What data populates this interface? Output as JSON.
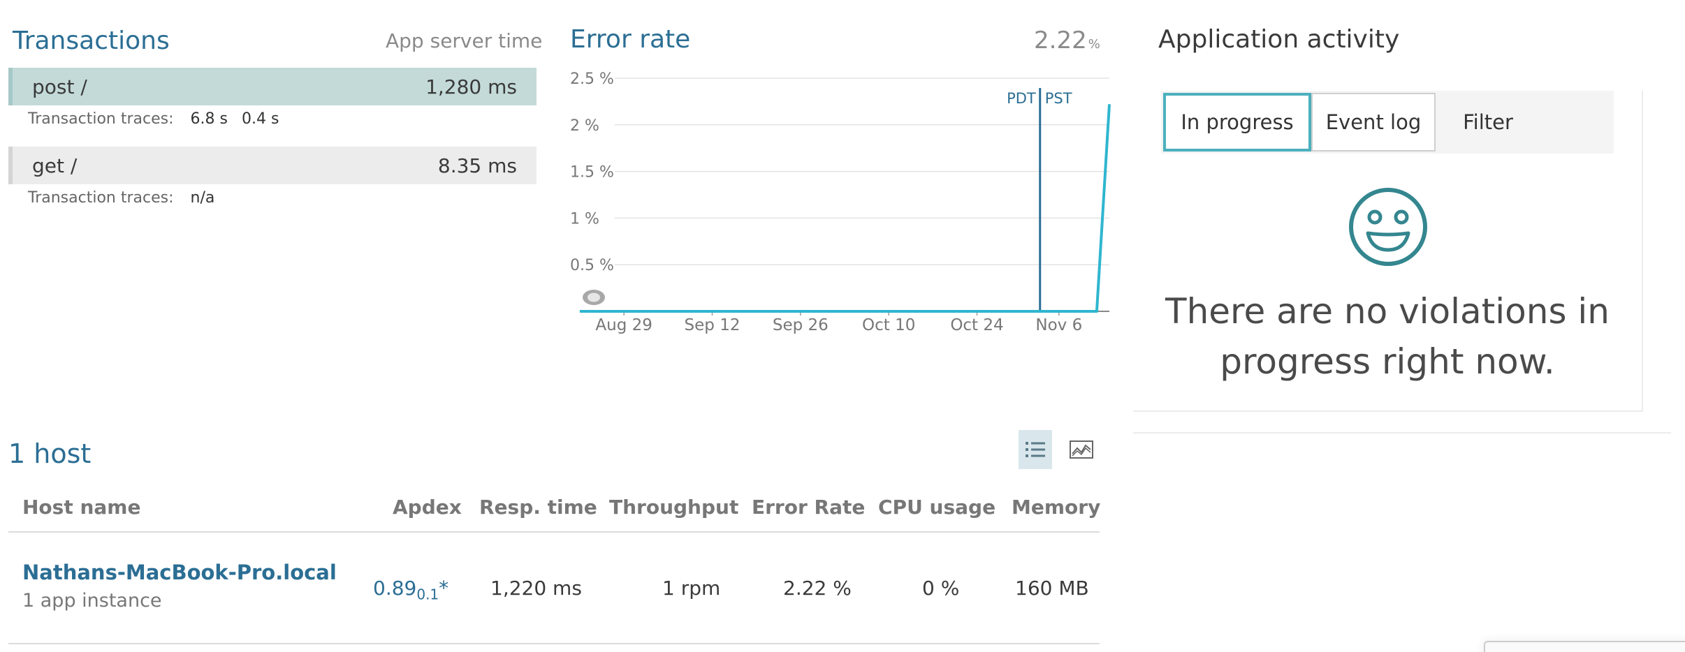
{
  "transactions": {
    "title": "Transactions",
    "subtitle": "App server time",
    "rows": [
      {
        "name": "post /",
        "time": "1,280 ms",
        "traces_label": "Transaction traces:",
        "traces": [
          "6.8 s",
          "0.4 s"
        ]
      },
      {
        "name": "get /",
        "time": "8.35 ms",
        "traces_label": "Transaction traces:",
        "traces_none": "n/a"
      }
    ]
  },
  "error_rate": {
    "title": "Error rate",
    "value": "2.22",
    "unit": "%",
    "timezone_labels": [
      "PDT",
      "PST"
    ]
  },
  "chart_data": {
    "type": "line",
    "title": "Error rate",
    "y_ticks": [
      "2.5 %",
      "2 %",
      "1.5 %",
      "1 %",
      "0.5 %"
    ],
    "x_ticks": [
      "Aug 29",
      "Sep 12",
      "Sep 26",
      "Oct 10",
      "Oct 24",
      "Nov 6"
    ],
    "ylim": [
      0,
      2.5
    ],
    "y_unit": "%",
    "x": [
      "Aug 22",
      "Nov 12",
      "Nov 14"
    ],
    "series": [
      {
        "values": [
          0,
          0,
          2.22
        ],
        "color": "#2fb6cf"
      }
    ],
    "annotation": {
      "label_left": "PDT",
      "label_right": "PST",
      "date": "Nov 3"
    },
    "grid": true
  },
  "activity": {
    "title": "Application activity",
    "tabs": [
      "In progress",
      "Event log",
      "Filter"
    ],
    "active_tab": "In progress",
    "empty_icon": "smiley-face-icon",
    "empty_message": "There are no violations in progress right now."
  },
  "hosts": {
    "title": "1 host",
    "view_icons": [
      "list-view-icon",
      "chart-view-icon"
    ],
    "columns": [
      "Host name",
      "Apdex",
      "Resp. time",
      "Throughput",
      "Error Rate",
      "CPU usage",
      "Memory"
    ],
    "rows": [
      {
        "name": "Nathans-MacBook-Pro.local",
        "instances": "1 app instance",
        "apdex": "0.89",
        "apdex_t": "0.1",
        "apdex_mark": "*",
        "resp_time": "1,220 ms",
        "throughput": "1 rpm",
        "error_rate": "2.22 %",
        "cpu": "0 %",
        "memory": "160 MB"
      }
    ]
  },
  "colors": {
    "accent": "#2b6e94",
    "series": "#2fb6cf",
    "selected_row": "#c3dad9",
    "active_tab_border": "#4cb0bd"
  }
}
